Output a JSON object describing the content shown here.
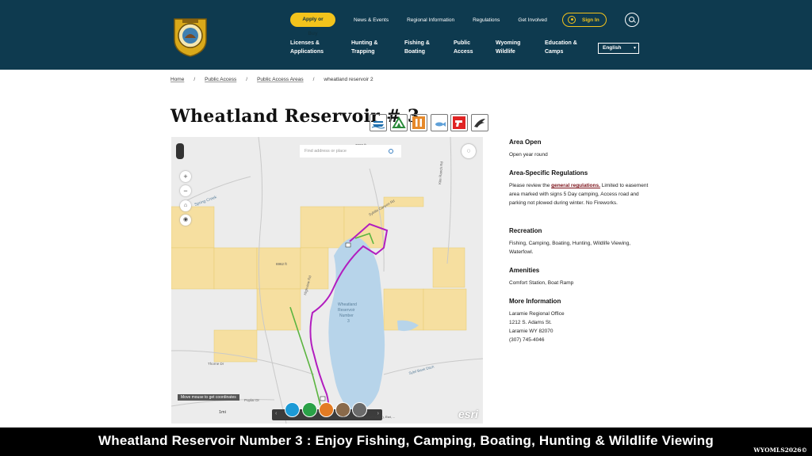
{
  "header": {
    "top_nav": {
      "apply_label": "Apply or Buy",
      "links": [
        "News & Events",
        "Regional Information",
        "Regulations",
        "Get Involved"
      ],
      "sign_in": "Sign In"
    },
    "main_nav": [
      "Licenses &\nApplications",
      "Hunting &\nTrapping",
      "Fishing &\nBoating",
      "Public\nAccess",
      "Wyoming\nWildlife",
      "Education &\nCamps"
    ],
    "language": "English"
  },
  "breadcrumb": {
    "items": [
      "Home",
      "Public Access",
      "Public Access Areas"
    ],
    "current": "wheatland reservoir 2"
  },
  "page_title": "Wheatland Reservoir # 3",
  "activity_icons": [
    "boating-icon",
    "camping-icon",
    "comfort-station-icon",
    "fishing-icon",
    "hunting-icon",
    "wildlife-viewing-icon"
  ],
  "map": {
    "search_placeholder": "Find address or place",
    "coords_hint": "Move mouse to get coordinates",
    "scale": "1mi",
    "attribution": "University of Wyoming (WYGISC), Esri, ...",
    "brand": "esri",
    "labels": {
      "reservoir": "Wheatland\nReservoir\nNumber\n3",
      "spring_creek": "Spring Creek",
      "elev_1": "6962 ft",
      "elev_2": "7000 ft",
      "thorne_dr": "Thorne Dr",
      "poplar_dr": "Poplar Dr",
      "sybille_road": "Sybille Canyon Rd",
      "spur_road": "Highview Rd",
      "east_road": "Kite Ranch Rd",
      "saint_road": "Sybil Bank Ditch"
    },
    "colors": {
      "state_land": "#f6dfa0",
      "water": "#b7d4ea",
      "boundary": "#b21dbf",
      "trail": "#5bb540"
    }
  },
  "info": {
    "area_open": {
      "heading": "Area Open",
      "text": "Open year round"
    },
    "regulations": {
      "heading": "Area-Specific Regulations",
      "before": "Please review the ",
      "link": "general regulations.",
      "after": " Limited to easement area marked with signs 5 Day camping, Access road and parking not plowed during winter. No Fireworks."
    },
    "recreation": {
      "heading": "Recreation",
      "text": "Fishing, Camping, Boating, Hunting, Wildlife Viewing, Waterfowl."
    },
    "amenities": {
      "heading": "Amenities",
      "text": "Comfort Station, Boat Ramp"
    },
    "more": {
      "heading": "More Information",
      "lines": [
        "Laramie Regional Office",
        "1212 S. Adams St.",
        "Laramie WY 82070",
        "(307) 745-4046"
      ]
    }
  },
  "caption": "Wheatland Reservoir Number 3 : Enjoy Fishing, Camping, Boating, Hunting & Wildlife Viewing",
  "watermark": "WYOMLS2026©"
}
